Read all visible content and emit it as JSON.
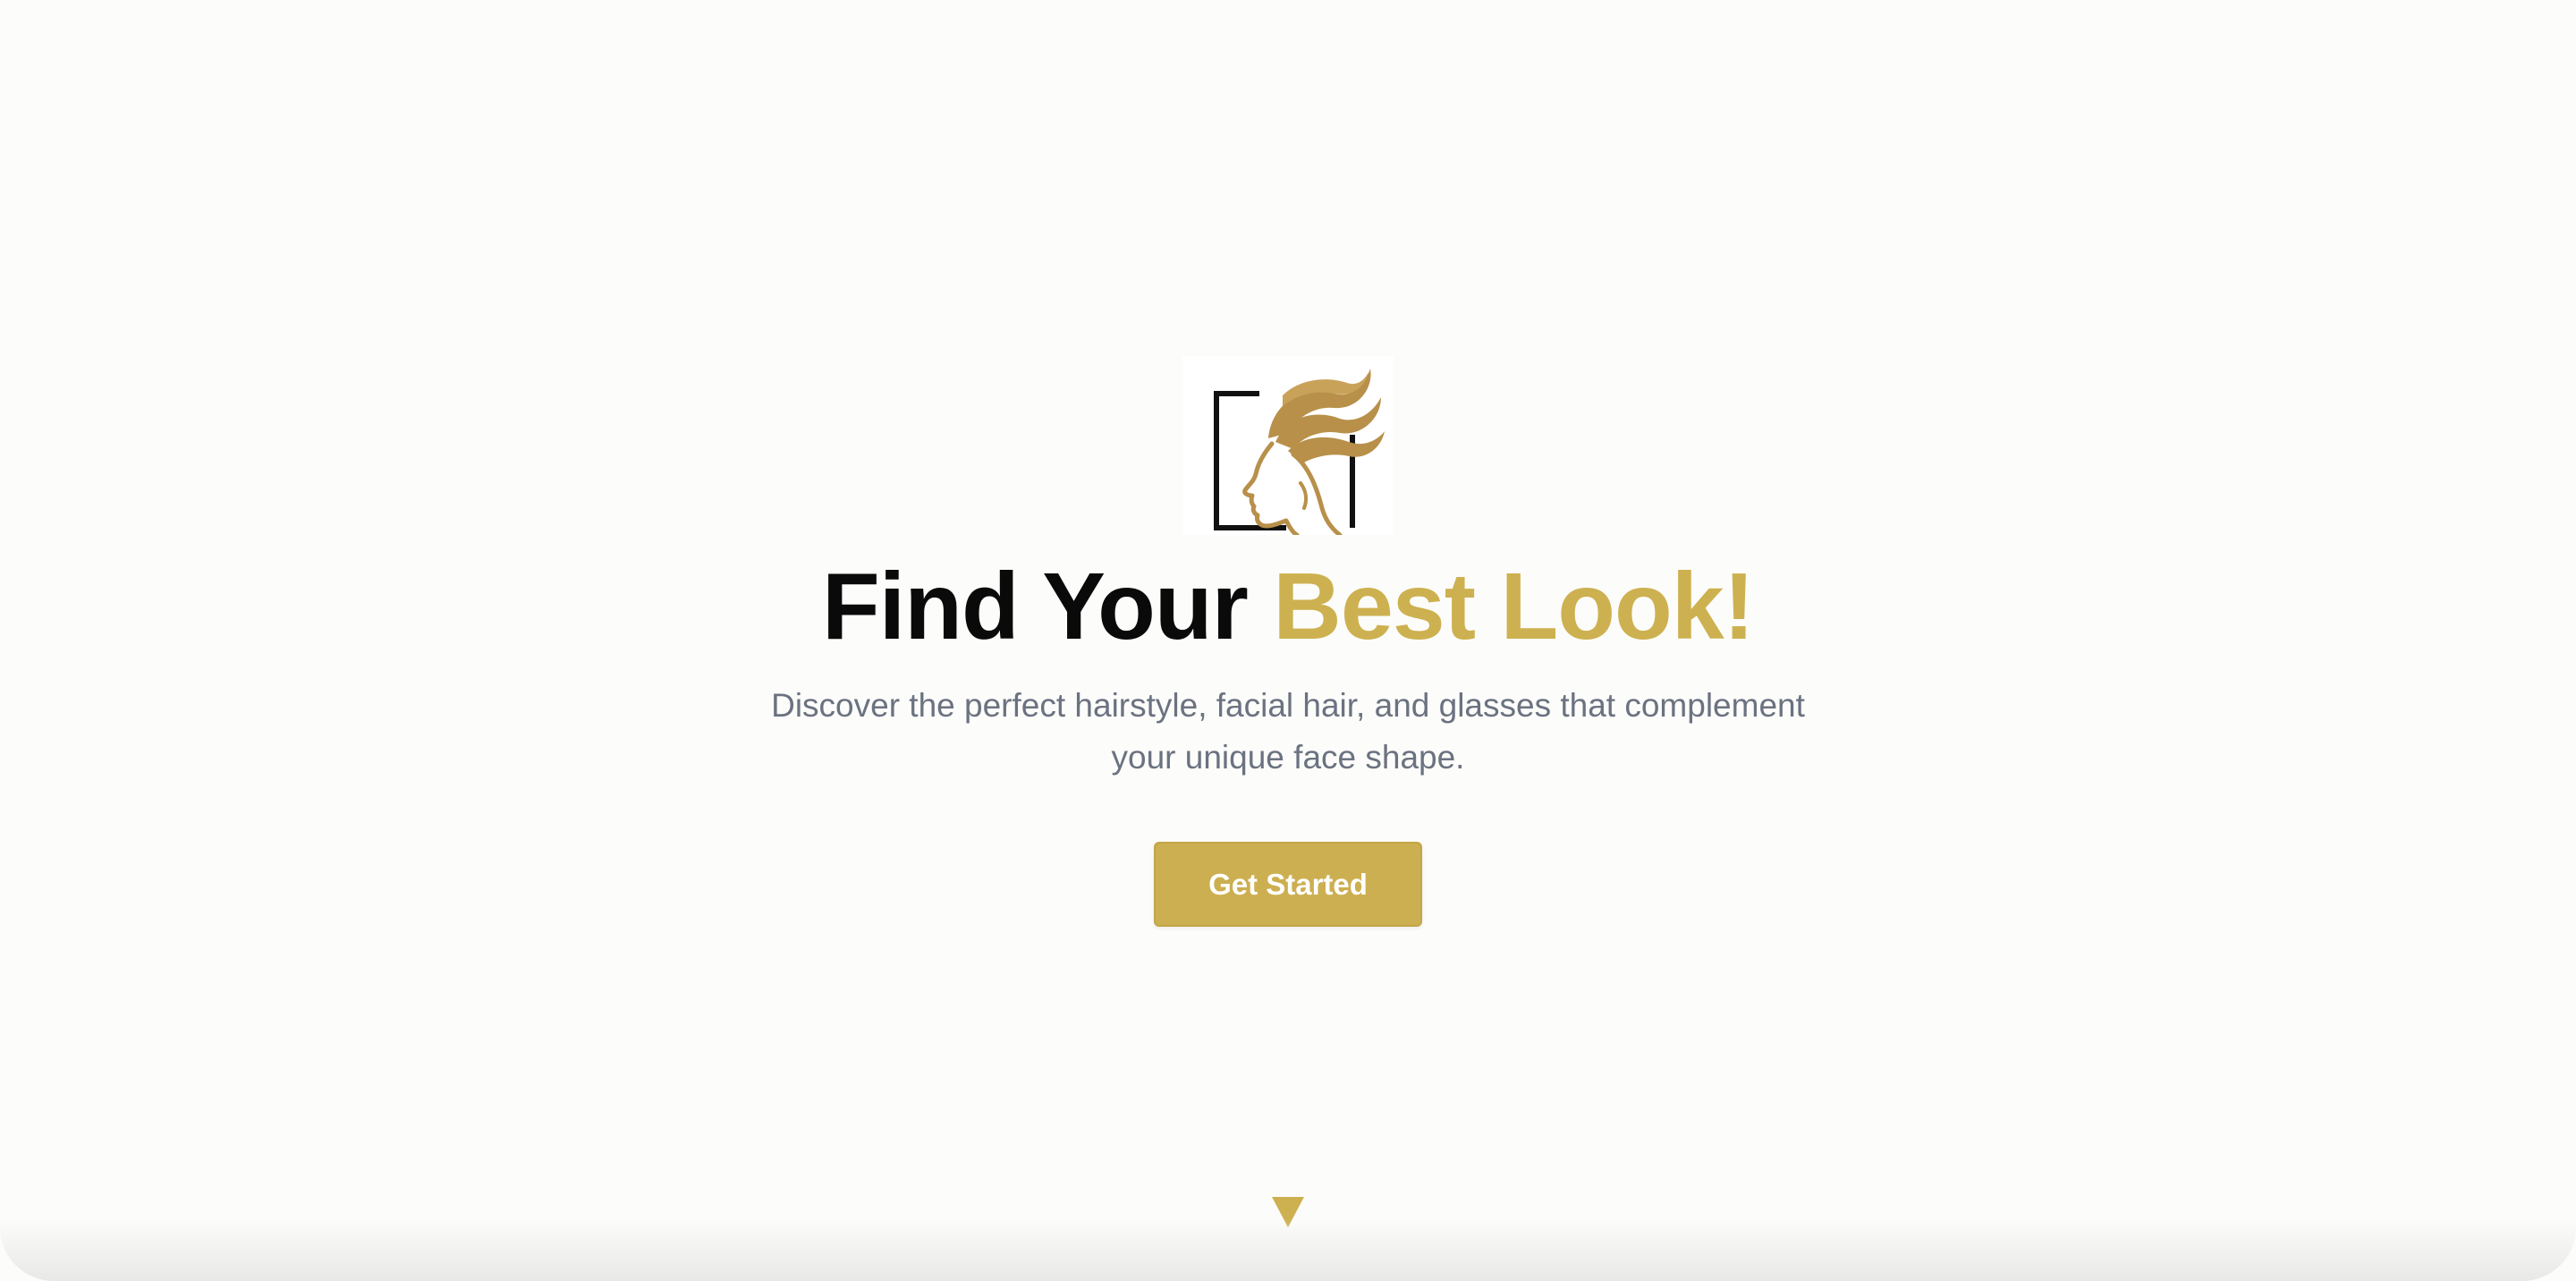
{
  "hero": {
    "logo_name": "face-profile-logo",
    "title_main": "Find Your ",
    "title_accent": "Best Look!",
    "subtitle": "Discover the perfect hairstyle, facial hair, and glasses that complement your unique face shape.",
    "cta_label": "Get Started",
    "scroll_icon": "triangle-down-icon"
  },
  "colors": {
    "accent": "#cdb150",
    "button": "#ccaf50",
    "logo_gold": "#b8904a",
    "title": "#0a0a0a",
    "subtitle": "#6b7280",
    "background": "#fcfcfa"
  }
}
